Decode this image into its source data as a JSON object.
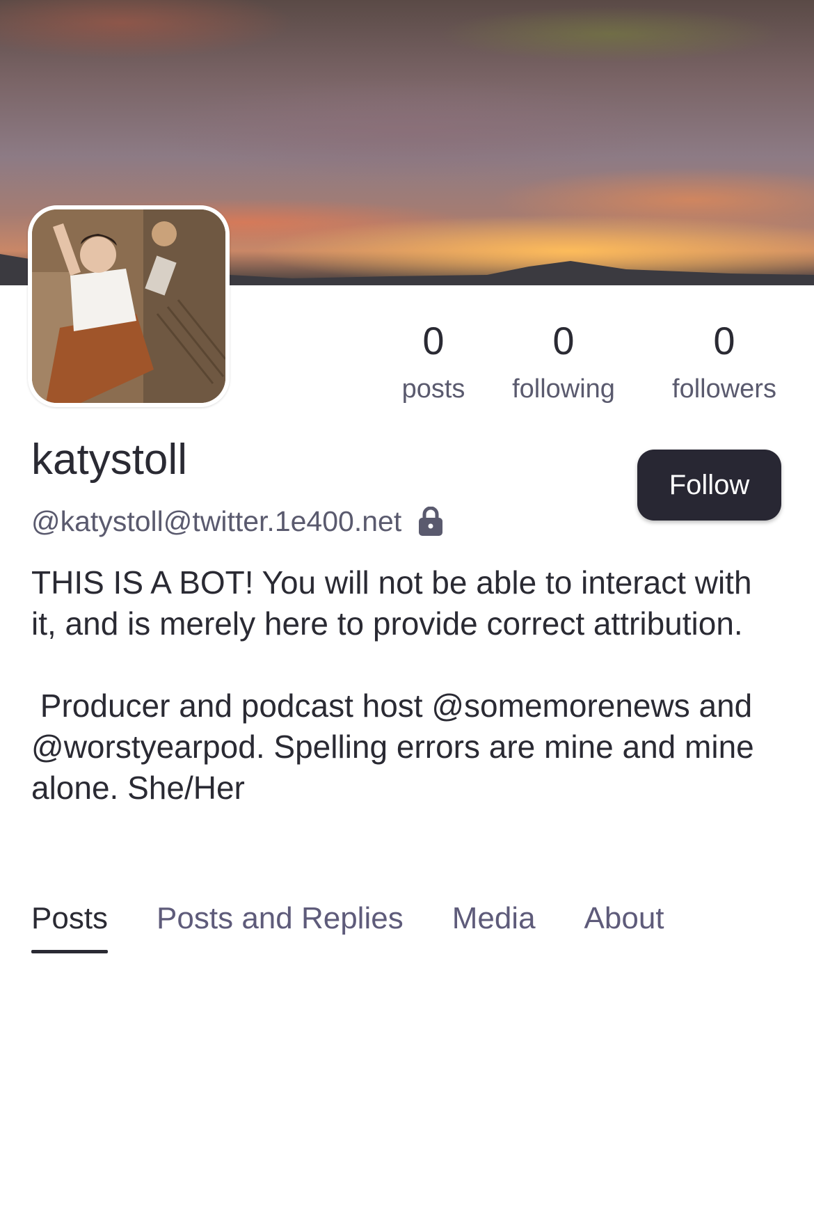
{
  "profile": {
    "display_name": "katystoll",
    "handle": "@katystoll@twitter.1e400.net",
    "bio_lines": [
      "THIS IS A BOT! You will not be able to interact with it, and is merely here to provide correct attribution.",
      " Producer and podcast host @somemorenews and @worstyearpod. Spelling errors are mine and mine alone. She/Her"
    ],
    "follow_label": "Follow"
  },
  "stats": {
    "posts": {
      "value": "0",
      "label": "posts"
    },
    "following": {
      "value": "0",
      "label": "following"
    },
    "followers": {
      "value": "0",
      "label": "followers"
    }
  },
  "tabs": [
    {
      "label": "Posts",
      "active": true
    },
    {
      "label": "Posts and Replies",
      "active": false
    },
    {
      "label": "Media",
      "active": false
    },
    {
      "label": "About",
      "active": false
    }
  ],
  "icons": {
    "lock": "lock-icon"
  },
  "colors": {
    "button_bg": "#282733",
    "text_primary": "#2a2a33",
    "text_secondary": "#5a5a6e",
    "tab_inactive": "#5e5b7a"
  }
}
